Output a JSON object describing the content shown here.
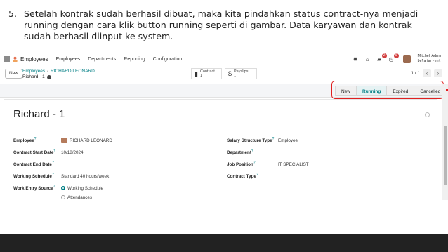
{
  "instruction": {
    "number": "5.",
    "text": "Setelah kontrak sudah berhasil dibuat, maka kita pindahkan status contract-nya menjadi running dengan cara klik button running seperti di gambar. Data karyawan dan kontrak sudah berhasil diinput ke system."
  },
  "navbar": {
    "brand": "Employees",
    "menu": [
      "Employees",
      "Departments",
      "Reporting",
      "Configuration"
    ],
    "chat_badge": "2",
    "activity_badge": "9",
    "user_name": "Mitchell Admin",
    "user_db": "belajar-ent"
  },
  "control": {
    "new_label": "New",
    "breadcrumb_parent": "Employees",
    "breadcrumb_current": "RICHARD LEONARD",
    "record_name": "Richard - 1",
    "contract_label": "Contract",
    "contract_count": "1",
    "payslips_label": "Payslips",
    "payslips_count": "1",
    "pager": "1 / 1"
  },
  "statusbar": {
    "steps": [
      "New",
      "Running",
      "Expired",
      "Cancelled"
    ],
    "active": "Running"
  },
  "form": {
    "title": "Richard - 1",
    "left": [
      {
        "label": "Employee",
        "value": "RICHARD LEONARD"
      },
      {
        "label": "Contract Start Date",
        "value": "10/18/2024"
      },
      {
        "label": "Contract End Date",
        "value": ""
      },
      {
        "label": "Working Schedule",
        "value": "Standard 40 hours/week"
      },
      {
        "label": "Work Entry Source",
        "value": "Working Schedule"
      }
    ],
    "work_entry_option2": "Attendances",
    "right": [
      {
        "label": "Salary Structure Type",
        "value": "Employee"
      },
      {
        "label": "Department",
        "value": ""
      },
      {
        "label": "Job Position",
        "value": "IT SPECIALIST"
      },
      {
        "label": "Contract Type",
        "value": ""
      }
    ]
  },
  "colors": {
    "accent": "#017e84",
    "highlight": "#e02020",
    "bottom_band": "#222222"
  }
}
